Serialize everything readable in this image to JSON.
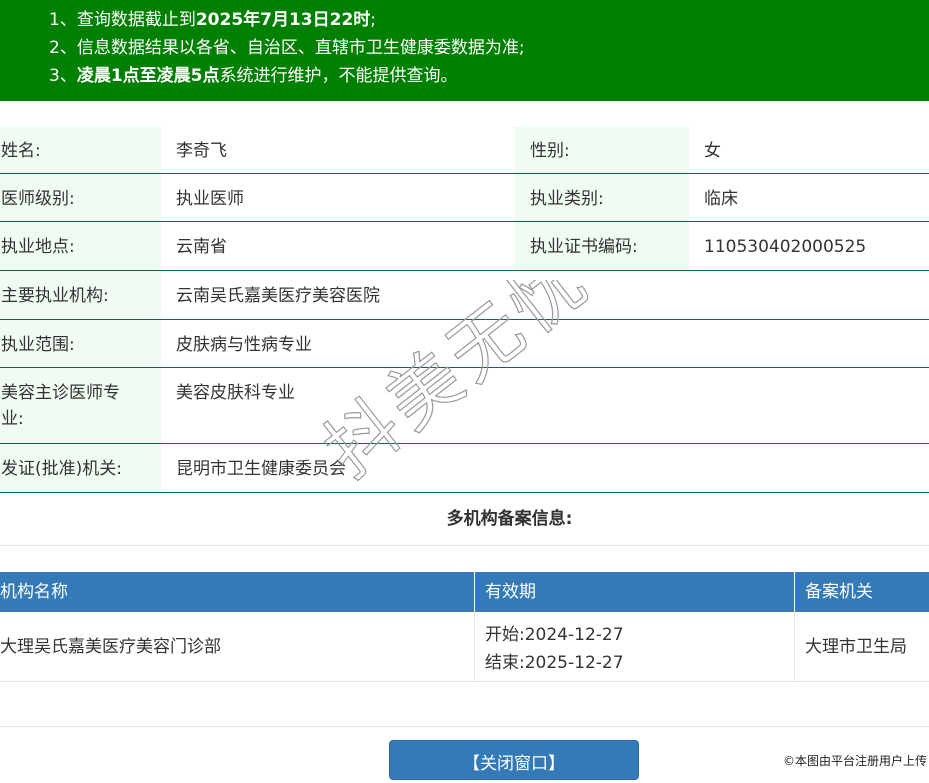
{
  "notice": {
    "line1": {
      "pre": "1、查询数据截止到",
      "bold": "2025年7月13日22时",
      "post": ";"
    },
    "line2": {
      "text": "2、信息数据结果以各省、自治区、直辖市卫生健康委数据为准;"
    },
    "line3": {
      "pre": "3、",
      "bold": "凌晨1点至凌晨5点",
      "post": "系统进行维护，不能提供查询。"
    },
    "bg_color": "#008000"
  },
  "info": {
    "name_label": "姓名:",
    "name_value": "李奇飞",
    "gender_label": "性别:",
    "gender_value": "女",
    "level_label": "医师级别:",
    "level_value": "执业医师",
    "type_label": "执业类别:",
    "type_value": "临床",
    "place_label": "执业地点:",
    "place_value": "云南省",
    "cert_label": "执业证书编码:",
    "cert_value": "110530402000525",
    "org_label": "主要执业机构:",
    "org_value": "云南吴氏嘉美医疗美容医院",
    "scope_label": "执业范围:",
    "scope_value": "皮肤病与性病专业",
    "beauty_label": "美容主诊医师专业:",
    "beauty_value": "美容皮肤科专业",
    "issuer_label": "发证(批准)机关:",
    "issuer_value": "昆明市卫生健康委员会"
  },
  "multi": {
    "title": "多机构备案信息:",
    "headers": {
      "org": "机构名称",
      "valid": "有效期",
      "filing": "备案机关"
    },
    "rows": [
      {
        "org": "大理吴氏嘉美医疗美容门诊部",
        "start_label": "开始:",
        "start": "2024-12-27",
        "end_label": "结束:",
        "end": "2025-12-27",
        "filing": "大理市卫生局"
      }
    ],
    "header_color": "#337ab7"
  },
  "footer": {
    "close_label": "【关闭窗口】",
    "copyright": "©本图由平台注册用户上传"
  },
  "watermark": {
    "text": "抖美无忧"
  }
}
